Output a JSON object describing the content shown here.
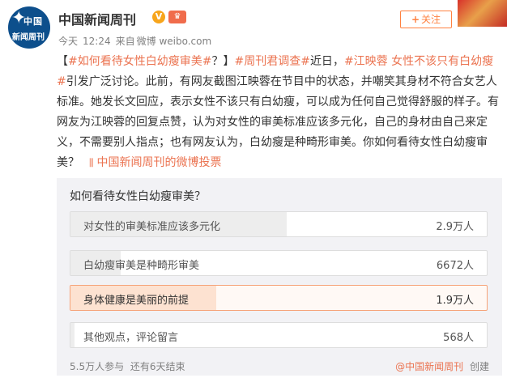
{
  "account": {
    "name": "中国新闻周刊",
    "avatar_text_top": "中国",
    "avatar_text_bottom": "新闻周刊",
    "verified_icon": "verified-badge-icon",
    "vip_icon": "vip-crown-icon"
  },
  "meta": {
    "day": "今天",
    "time": "12:24",
    "source_prefix": "来自",
    "source": "微博 weibo.com"
  },
  "follow": {
    "plus": "+",
    "label": "关注"
  },
  "post": {
    "p1": "【",
    "tag1": "#如何看待女性白幼瘦审美#",
    "p2": "？】",
    "tag2": "#周刊君调查#",
    "p3": "近日，",
    "tag3": "#江映蓉 女性不该只有白幼瘦#",
    "p4": "引发广泛讨论。此前，有网友截图江映蓉在节目中的状态，并嘲笑其身材不符合女艺人标准。她发长文回应，表示女性不该只有白幼瘦，可以成为任何自己觉得舒服的样子。有网友为江映蓉的回复点赞，认为对女性的审美标准应该多元化，自己的身材由自己来定义，不需要别人指点；也有网友认为，白幼瘦是种畸形审美。你如何看待女性白幼瘦审美？",
    "vote_icon": "poll-icon",
    "vote_link": "中国新闻周刊的微博投票"
  },
  "poll": {
    "title": "如何看待女性白幼瘦审美？",
    "options": [
      {
        "label": "对女性的审美标准应该多元化",
        "count": "2.9万人",
        "share": 0.52,
        "selected": false
      },
      {
        "label": "白幼瘦审美是种畸形审美",
        "count": "6672人",
        "share": 0.12,
        "selected": false
      },
      {
        "label": "身体健康是美丽的前提",
        "count": "1.9万人",
        "share": 0.35,
        "selected": true
      },
      {
        "label": "其他观点，评论留言",
        "count": "568人",
        "share": 0.01,
        "selected": false
      }
    ],
    "participants": "5.5万人参与",
    "remaining": "还有6天结束",
    "creator": "@中国新闻周刊",
    "created": "创建"
  },
  "colors": {
    "accent": "#eb7350",
    "avatar_bg": "#0d4f8c",
    "follow": "#ff8140"
  }
}
